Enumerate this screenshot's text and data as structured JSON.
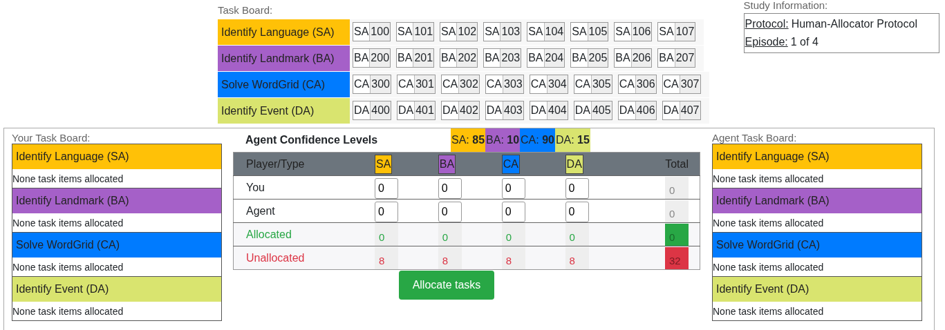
{
  "task_board": {
    "title": "Task Board:",
    "rows": [
      {
        "label": "Identify Language (SA)",
        "color": "#ffc107",
        "items": [
          {
            "prefix": "SA",
            "number": "100"
          },
          {
            "prefix": "SA",
            "number": "101"
          },
          {
            "prefix": "SA",
            "number": "102"
          },
          {
            "prefix": "SA",
            "number": "103"
          },
          {
            "prefix": "SA",
            "number": "104"
          },
          {
            "prefix": "SA",
            "number": "105"
          },
          {
            "prefix": "SA",
            "number": "106"
          },
          {
            "prefix": "SA",
            "number": "107"
          }
        ]
      },
      {
        "label": "Identify Landmark (BA)",
        "color": "#a560c8",
        "items": [
          {
            "prefix": "BA",
            "number": "200"
          },
          {
            "prefix": "BA",
            "number": "201"
          },
          {
            "prefix": "BA",
            "number": "202"
          },
          {
            "prefix": "BA",
            "number": "203"
          },
          {
            "prefix": "BA",
            "number": "204"
          },
          {
            "prefix": "BA",
            "number": "205"
          },
          {
            "prefix": "BA",
            "number": "206"
          },
          {
            "prefix": "BA",
            "number": "207"
          }
        ]
      },
      {
        "label": "Solve WordGrid (CA)",
        "color": "#007bff",
        "items": [
          {
            "prefix": "CA",
            "number": "300"
          },
          {
            "prefix": "CA",
            "number": "301"
          },
          {
            "prefix": "CA",
            "number": "302"
          },
          {
            "prefix": "CA",
            "number": "303"
          },
          {
            "prefix": "CA",
            "number": "304"
          },
          {
            "prefix": "CA",
            "number": "305"
          },
          {
            "prefix": "CA",
            "number": "306"
          },
          {
            "prefix": "CA",
            "number": "307"
          }
        ]
      },
      {
        "label": "Identify Event (DA)",
        "color": "#d9e46f",
        "items": [
          {
            "prefix": "DA",
            "number": "400"
          },
          {
            "prefix": "DA",
            "number": "401"
          },
          {
            "prefix": "DA",
            "number": "402"
          },
          {
            "prefix": "DA",
            "number": "403"
          },
          {
            "prefix": "DA",
            "number": "404"
          },
          {
            "prefix": "DA",
            "number": "405"
          },
          {
            "prefix": "DA",
            "number": "406"
          },
          {
            "prefix": "DA",
            "number": "407"
          }
        ]
      }
    ]
  },
  "study_info": {
    "title": "Study Information:",
    "fields": [
      {
        "label": "Protocol:",
        "value": "Human-Allocator Protocol"
      },
      {
        "label": "Episode:",
        "value": "1 of 4"
      }
    ]
  },
  "your_board": {
    "title": "Your Task Board:",
    "sections": [
      {
        "label": "Identify Language (SA)",
        "color": "#ffc107",
        "note": "None task items allocated"
      },
      {
        "label": "Identify Landmark (BA)",
        "color": "#a560c8",
        "note": "None task items allocated"
      },
      {
        "label": "Solve WordGrid (CA)",
        "color": "#007bff",
        "note": "None task items allocated"
      },
      {
        "label": "Identify Event (DA)",
        "color": "#d9e46f",
        "note": "None task items allocated"
      }
    ]
  },
  "confidence": {
    "title": "Agent Confidence Levels",
    "levels": [
      {
        "label": "SA:",
        "value": "85",
        "color": "#ffc107"
      },
      {
        "label": "BA:",
        "value": "10",
        "color": "#a560c8"
      },
      {
        "label": "CA:",
        "value": "90",
        "color": "#007bff"
      },
      {
        "label": "DA:",
        "value": "15",
        "color": "#d9e46f"
      }
    ]
  },
  "table": {
    "columns": [
      {
        "label": "Player/Type"
      },
      {
        "label": "SA",
        "color": "#ffc107"
      },
      {
        "label": "BA",
        "color": "#a560c8"
      },
      {
        "label": "CA",
        "color": "#007bff"
      },
      {
        "label": "DA",
        "color": "#d9e46f"
      },
      {
        "label": "Total"
      }
    ],
    "rows": [
      {
        "label": "You",
        "kind": "input",
        "values": [
          "0",
          "0",
          "0",
          "0"
        ],
        "total": "0"
      },
      {
        "label": "Agent",
        "kind": "input",
        "values": [
          "0",
          "0",
          "0",
          "0"
        ],
        "total": "0"
      },
      {
        "label": "Allocated",
        "kind": "allocated",
        "values": [
          "0",
          "0",
          "0",
          "0"
        ],
        "total": "0"
      },
      {
        "label": "Unallocated",
        "kind": "unallocated",
        "values": [
          "8",
          "8",
          "8",
          "8"
        ],
        "total": "32"
      }
    ]
  },
  "allocate_button": "Allocate tasks",
  "agent_board": {
    "title": "Agent Task Board:",
    "sections": [
      {
        "label": "Identify Language (SA)",
        "color": "#ffc107",
        "note": "None task items allocated"
      },
      {
        "label": "Identify Landmark (BA)",
        "color": "#a560c8",
        "note": "None task items allocated"
      },
      {
        "label": "Solve WordGrid (CA)",
        "color": "#007bff",
        "note": "None task items allocated"
      },
      {
        "label": "Identify Event (DA)",
        "color": "#d9e46f",
        "note": "None task items allocated"
      }
    ]
  }
}
